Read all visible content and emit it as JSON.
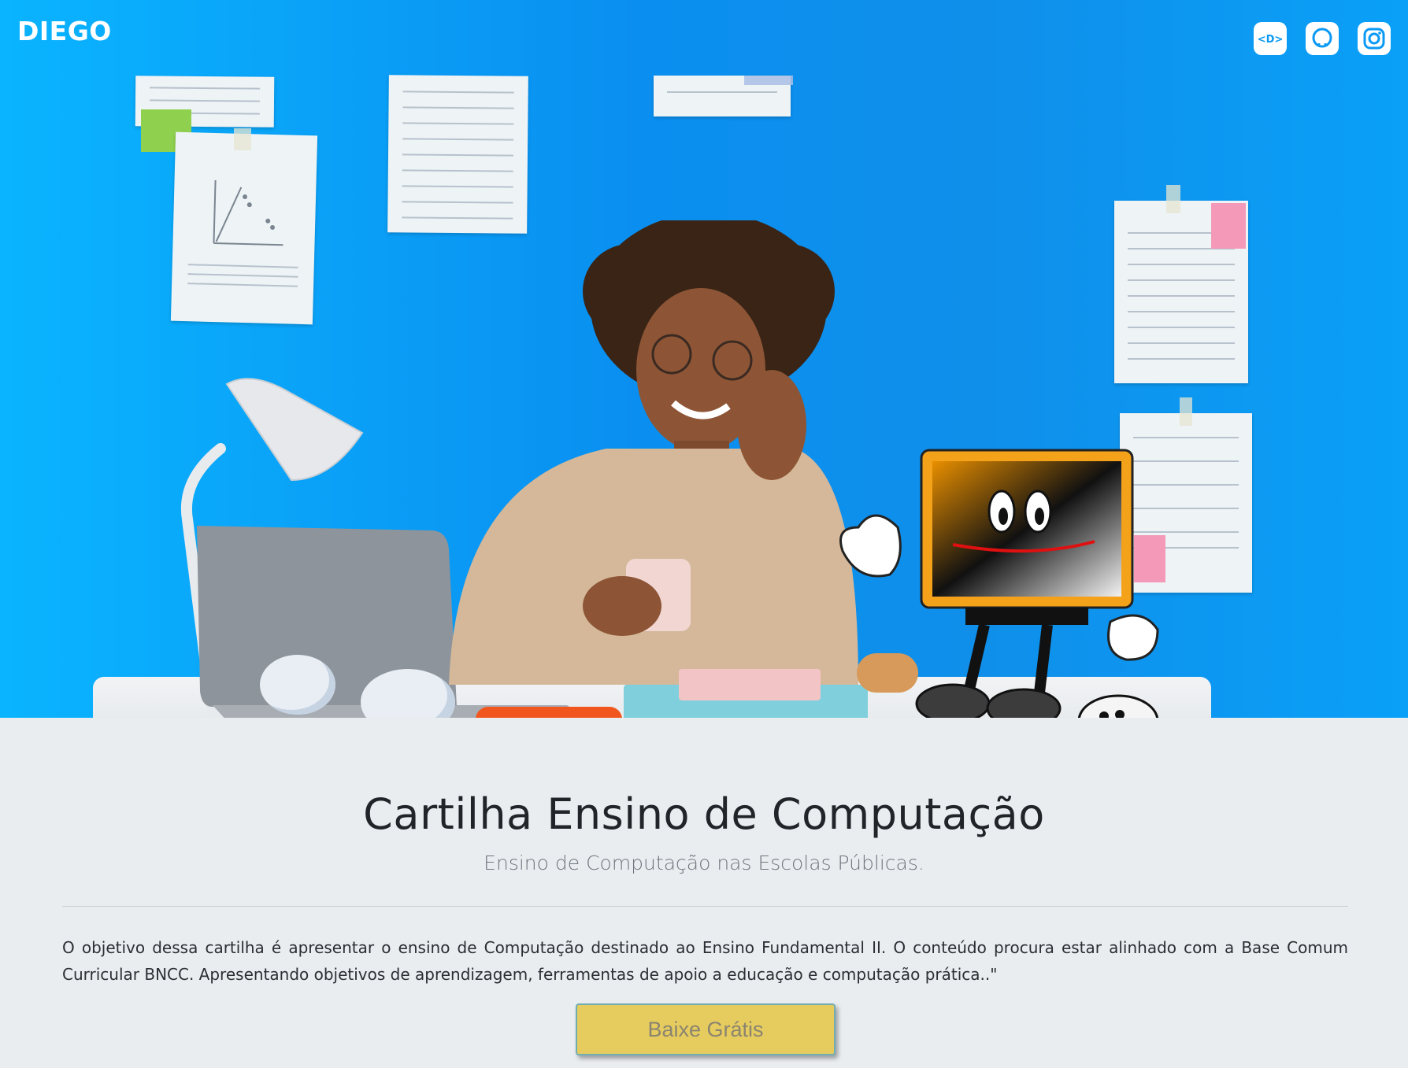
{
  "navbar": {
    "brand": "DIEGO",
    "icons": [
      "devto-icon",
      "github-icon",
      "instagram-icon"
    ]
  },
  "hero": {
    "image": "woman-on-phone-at-desk-with-cartoon-computer",
    "colors": {
      "background": "#0a9af5",
      "monitor_frame": "#f4a21a"
    }
  },
  "main": {
    "title": "Cartilha Ensino de Computação",
    "subtitle": "Ensino de Computação nas Escolas Públicas.",
    "description": "O objetivo dessa cartilha é apresentar o ensino de Computação destinado ao Ensino Fundamental II. O conteúdo procura estar alinhado com a Base Comum Curricular BNCC. Apresentando objetivos de aprendizagem, ferramentas de apoio a educação e computação prática..\"",
    "download_label": "Baixe Grátis"
  },
  "colors": {
    "button": "#e6cc5e",
    "page_bg": "#eaedf0"
  }
}
